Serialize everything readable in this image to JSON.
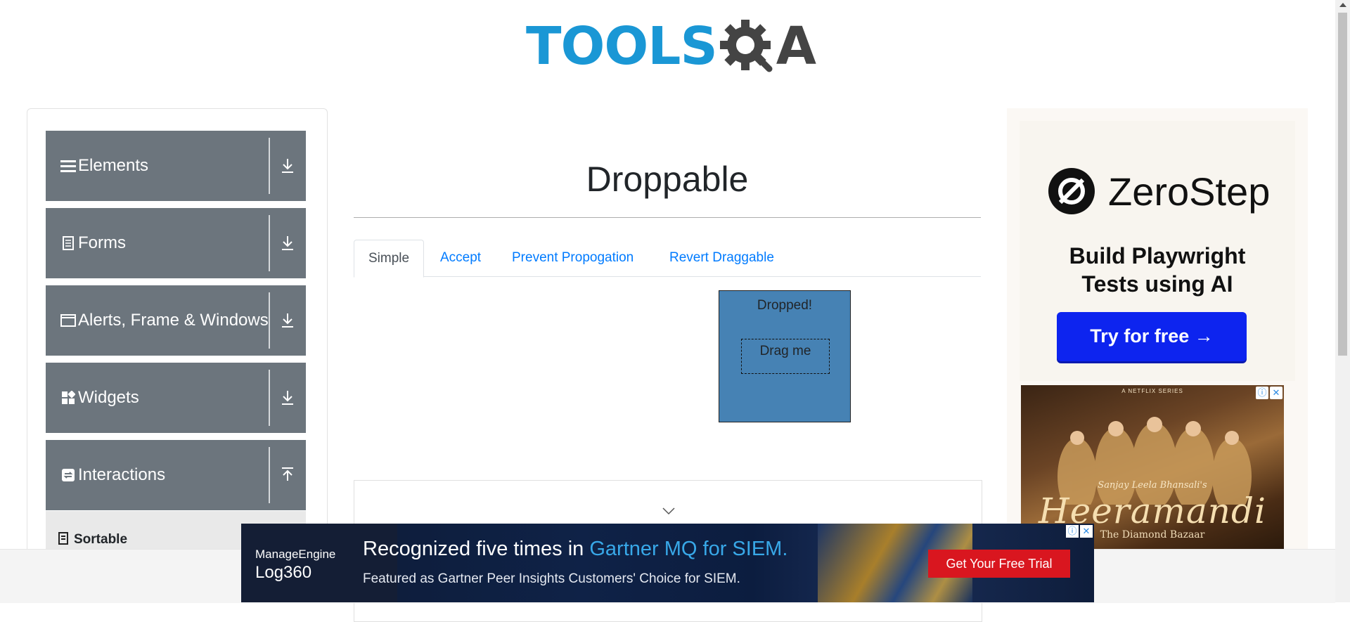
{
  "header": {
    "logo_text": "TOOLS",
    "logo_qa": "A"
  },
  "sidebar": {
    "groups": [
      {
        "label": "Elements",
        "icon": "hamburger-icon"
      },
      {
        "label": "Forms",
        "icon": "document-icon"
      },
      {
        "label": "Alerts, Frame & Windows",
        "icon": "window-icon"
      },
      {
        "label": "Widgets",
        "icon": "widgets-icon"
      },
      {
        "label": "Interactions",
        "icon": "interactions-icon"
      }
    ],
    "submenu": {
      "label": "Sortable",
      "icon": "sortable-icon"
    }
  },
  "main": {
    "title": "Droppable",
    "tabs": [
      {
        "label": "Simple",
        "active": true
      },
      {
        "label": "Accept",
        "active": false
      },
      {
        "label": "Prevent Propogation",
        "active": false
      },
      {
        "label": "Revert Draggable",
        "active": false
      }
    ],
    "droppable_text": "Dropped!",
    "draggable_text": "Drag me"
  },
  "ad_right": {
    "brand": "ZeroStep",
    "headline_line1": "Build Playwright",
    "headline_line2": "Tests using AI",
    "cta": "Try for free →",
    "netflix": {
      "top_label": "A NETFLIX SERIES",
      "credit": "Sanjay Leela Bhansali's",
      "title": "Heeramandi",
      "subtitle": "The Diamond Bazaar"
    }
  },
  "banner": {
    "brand": "ManageEngine",
    "product": "Log360",
    "headline_prefix": "Recognized five times in ",
    "headline_highlight": "Gartner MQ for SIEM.",
    "subline": "Featured as Gartner Peer Insights Customers' Choice for SIEM.",
    "cta": "Get Your Free Trial"
  },
  "colors": {
    "sidebar_group": "#6c757d",
    "drop_box": "#4682b4",
    "tab_link": "#007bff",
    "zerostep_button": "#0d24ef",
    "banner_cta": "#d9161f"
  }
}
